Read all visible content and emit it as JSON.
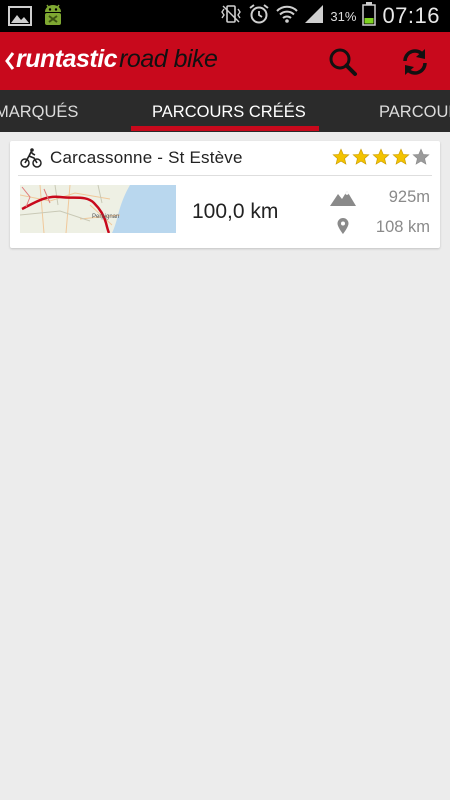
{
  "status_bar": {
    "battery_percent": "31%",
    "time": "07:16",
    "icons": [
      "gallery-icon",
      "android-debug-icon",
      "vibrate-icon",
      "alarm-icon",
      "wifi-icon",
      "signal-icon",
      "battery-icon"
    ]
  },
  "app_bar": {
    "brand": "runtastic",
    "product": "road bike",
    "actions": [
      "search-icon",
      "refresh-icon"
    ]
  },
  "tabs": [
    {
      "label": "MARQUÉS",
      "active": false
    },
    {
      "label": "PARCOURS CRÉÉS",
      "active": true
    },
    {
      "label": "PARCOURS",
      "active": false
    }
  ],
  "routes": [
    {
      "title": "Carcassonne - St Estève",
      "rating": 4,
      "rating_max": 5,
      "distance": "100,0 km",
      "elevation": "925m",
      "length_from_location": "108 km",
      "map_place_label": "Perpignan"
    }
  ],
  "colors": {
    "accent_red": "#c8091c",
    "tab_bg": "#2b2b2b",
    "page_bg": "#ececec",
    "star_gold": "#f2c200",
    "star_empty": "#9a9a9a"
  }
}
